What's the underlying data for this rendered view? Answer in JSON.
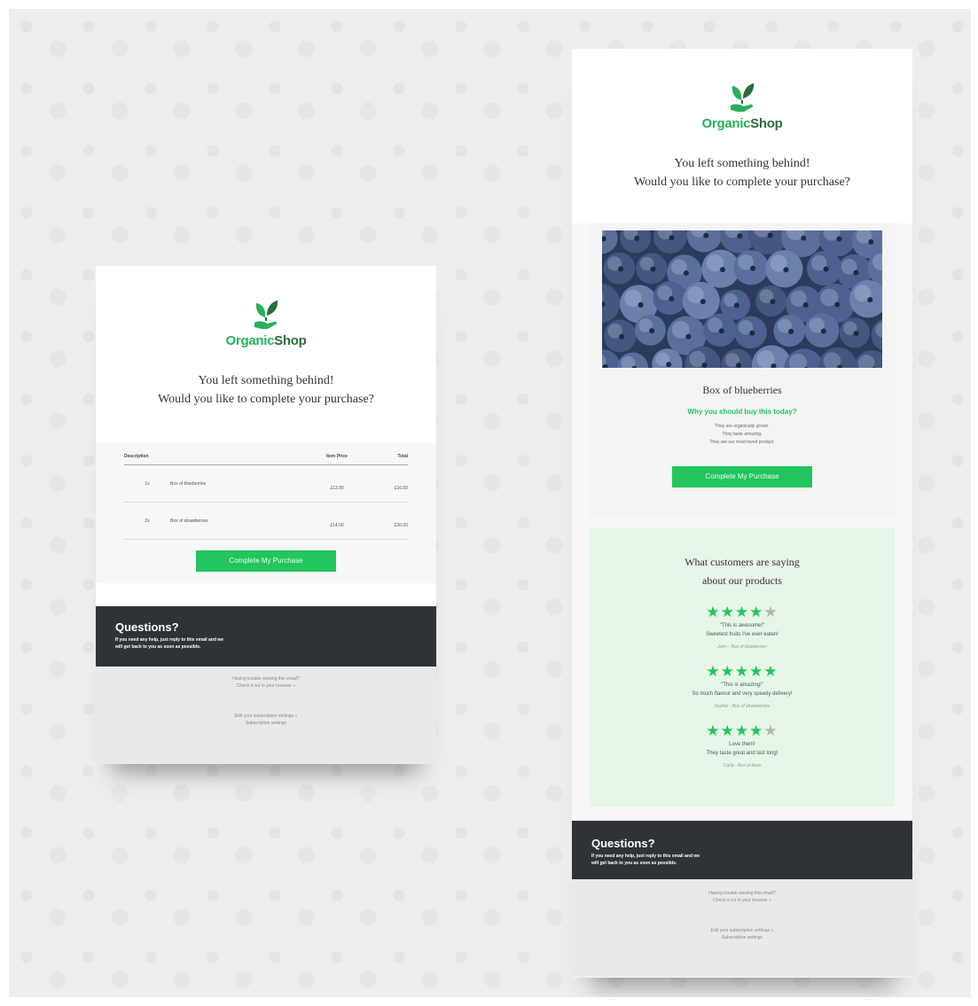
{
  "colors": {
    "brand_green": "#27b05a",
    "brand_dark_green": "#2d6b3c",
    "button": "#22c55e",
    "dark_panel": "#2f3337",
    "footer_bg": "#e8e9eb",
    "reviews_bg": "#e6f6e7"
  },
  "brand": {
    "part1": "Organic",
    "part2": "Shop",
    "icon": "leaf-hand-icon"
  },
  "headline": {
    "line1": "You left something behind!",
    "line2": "Would you like to complete your purchase?"
  },
  "cart": {
    "headers": {
      "description": "Description",
      "item_price": "Item Price",
      "total": "Total"
    },
    "rows": [
      {
        "qty": "1x",
        "name": "Box of blueberries",
        "price": "£13.00",
        "total": "£16.00"
      },
      {
        "qty": "2x",
        "name": "Box of strawberries",
        "price": "£14.00",
        "total": "£30.00"
      }
    ]
  },
  "cta_label": "Complete My Purchase",
  "questions": {
    "title": "Questions?",
    "text_line1": "If you need any help, just reply to this email and we",
    "text_line2": "will get back to you as soon as possible."
  },
  "footer": {
    "trouble": "Having trouble viewing this email?",
    "browser_link": "Check it out in your browser »",
    "settings": "Edit your subscription settings »",
    "settings_link": "Subscription settings"
  },
  "product": {
    "name": "Box of blueberries",
    "why": "Why you should buy this today?",
    "reasons": [
      "They are organically grown.",
      "They taste amazing.",
      "They are our most loved product."
    ],
    "image_icon": "blueberries-photo"
  },
  "reviews": {
    "title_line1": "What customers are saying",
    "title_line2": "about our products",
    "items": [
      {
        "rating": 4,
        "quote": "\"This is awesome!\"",
        "body": "Sweetest fruits I've ever eaten!",
        "author": "John - Box of blueberries"
      },
      {
        "rating": 5,
        "quote": "\"This is amazing!\"",
        "body": "So much flavour and very speedy delivery!",
        "author": "Sophie - Box of strawberries"
      },
      {
        "rating": 4,
        "quote": "Love them!",
        "body": "They taste great and last long!",
        "author": "Carla - Box of kiwis"
      }
    ]
  }
}
